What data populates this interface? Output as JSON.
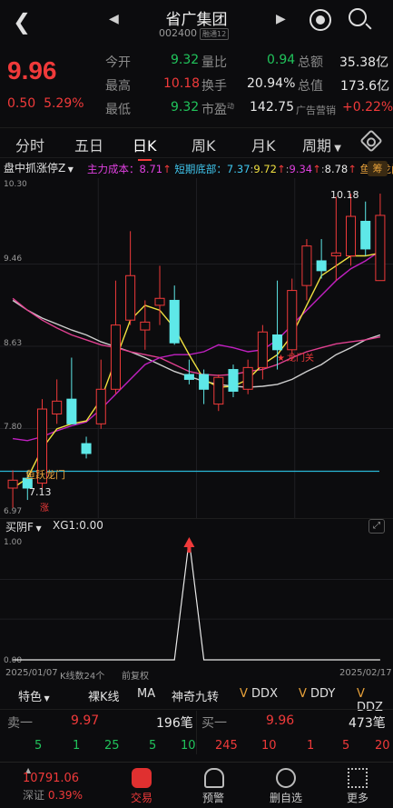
{
  "header": {
    "title": "省广集团",
    "code": "002400",
    "badge": "融通12"
  },
  "quote": {
    "price": "9.96",
    "change": "0.50",
    "change_pct": "5.29%",
    "rows": [
      {
        "l1": "今开",
        "v1": "9.32",
        "l2": "量比",
        "v2": "0.94",
        "l3": "总额",
        "v3": "35.38亿"
      },
      {
        "l1": "最高",
        "v1": "10.18",
        "l2": "换手",
        "v2": "20.94%",
        "l3": "总值",
        "v3": "173.6亿"
      },
      {
        "l1": "最低",
        "v1": "9.32",
        "l2": "市盈",
        "l2sup": "动",
        "v2": "142.75",
        "l3": "广告营销",
        "v3": "+0.22%"
      }
    ]
  },
  "tabs": [
    "分时",
    "五日",
    "日K",
    "周K",
    "月K",
    "周期"
  ],
  "indicator": {
    "selector": "盘中抓涨停Z",
    "main_cost_label": "主力成本：",
    "main_cost": "8.71",
    "short_bottom_label": "短期底部：",
    "short_bottom": "7.37",
    "v1": "9.72",
    "v2": "9.34",
    "v3": "8.78",
    "tail": "鱼跃龙门",
    "pill": "筹"
  },
  "price_axis": [
    "10.30",
    "9.46",
    "8.63",
    "7.80",
    "6.97"
  ],
  "annotations": {
    "high": "10.18",
    "low": "7.13",
    "yuyue": "鱼跃龙门",
    "longmen": "龙门关",
    "zhang": "涨"
  },
  "sub": {
    "selector": "买阴F",
    "xg_label": "XG1:",
    "xg_value": "0.00",
    "axis_top": "1.00",
    "axis_bottom": "0.00"
  },
  "date_row": {
    "start": "2025/01/07",
    "count": "K线数24个",
    "adj": "前复权",
    "end": "2025/02/17"
  },
  "tools": [
    "特色",
    "裸K线",
    "MA",
    "神奇九转",
    "DDX",
    "DDY",
    "DDZ"
  ],
  "orders": {
    "sell_label": "卖一",
    "sell_price": "9.97",
    "sell_vol": "196笔",
    "buy_label": "买一",
    "buy_price": "9.96",
    "buy_vol": "473笔",
    "sell_detail": [
      "5",
      "1",
      "25",
      "5",
      "10"
    ],
    "buy_detail": [
      "245",
      "10",
      "1",
      "5",
      "20"
    ]
  },
  "index": {
    "value": "10791.06",
    "name": "深证",
    "pct": "0.39%"
  },
  "nav": [
    "交易",
    "预警",
    "删自选",
    "更多"
  ],
  "chart_data": {
    "type": "candlestick",
    "ylim": [
      6.97,
      10.3
    ],
    "candles": [
      {
        "o": 7.2,
        "h": 7.38,
        "l": 7.0,
        "c": 7.28
      },
      {
        "o": 7.3,
        "h": 7.38,
        "l": 7.08,
        "c": 7.2
      },
      {
        "o": 7.25,
        "h": 8.1,
        "l": 7.2,
        "c": 8.0
      },
      {
        "o": 7.95,
        "h": 8.3,
        "l": 7.85,
        "c": 8.08
      },
      {
        "o": 8.1,
        "h": 8.52,
        "l": 7.9,
        "c": 7.85
      },
      {
        "o": 7.65,
        "h": 7.72,
        "l": 7.5,
        "c": 7.55
      },
      {
        "o": 7.85,
        "h": 8.5,
        "l": 7.8,
        "c": 8.2
      },
      {
        "o": 8.2,
        "h": 9.3,
        "l": 8.15,
        "c": 8.85
      },
      {
        "o": 8.9,
        "h": 9.8,
        "l": 8.85,
        "c": 9.35
      },
      {
        "o": 8.8,
        "h": 9.1,
        "l": 8.6,
        "c": 8.88
      },
      {
        "o": 9.05,
        "h": 9.45,
        "l": 8.85,
        "c": 9.12
      },
      {
        "o": 9.1,
        "h": 9.25,
        "l": 8.65,
        "c": 8.67
      },
      {
        "o": 8.35,
        "h": 8.5,
        "l": 8.25,
        "c": 8.3
      },
      {
        "o": 8.35,
        "h": 8.4,
        "l": 8.05,
        "c": 8.2
      },
      {
        "o": 8.05,
        "h": 8.35,
        "l": 7.98,
        "c": 8.32
      },
      {
        "o": 8.4,
        "h": 8.45,
        "l": 8.12,
        "c": 8.18
      },
      {
        "o": 8.2,
        "h": 8.5,
        "l": 8.15,
        "c": 8.42
      },
      {
        "o": 8.42,
        "h": 8.85,
        "l": 8.3,
        "c": 8.78
      },
      {
        "o": 8.75,
        "h": 9.3,
        "l": 8.4,
        "c": 8.6
      },
      {
        "o": 8.6,
        "h": 9.32,
        "l": 8.55,
        "c": 9.2
      },
      {
        "o": 9.25,
        "h": 9.72,
        "l": 9.1,
        "c": 9.65
      },
      {
        "o": 9.5,
        "h": 9.72,
        "l": 9.32,
        "c": 9.4
      },
      {
        "o": 9.55,
        "h": 10.15,
        "l": 9.3,
        "c": 9.58
      },
      {
        "o": 9.55,
        "h": 10.18,
        "l": 9.45,
        "c": 9.95
      },
      {
        "o": 9.9,
        "h": 10.1,
        "l": 9.55,
        "c": 9.62
      },
      {
        "o": 9.3,
        "h": 10.18,
        "l": 9.32,
        "c": 9.96
      }
    ],
    "ma_yellow": [
      7.2,
      7.3,
      7.6,
      7.8,
      7.85,
      7.88,
      8.1,
      8.5,
      8.9,
      9.05,
      9.0,
      8.82,
      8.55,
      8.3,
      8.22,
      8.23,
      8.3,
      8.45,
      8.55,
      8.75,
      9.05,
      9.35,
      9.45,
      9.55,
      9.55,
      9.58
    ],
    "ma_magenta": [
      7.7,
      7.68,
      7.72,
      7.78,
      7.83,
      7.87,
      8.0,
      8.15,
      8.3,
      8.45,
      8.52,
      8.55,
      8.55,
      8.58,
      8.65,
      8.62,
      8.58,
      8.6,
      8.7,
      8.85,
      9.0,
      9.15,
      9.3,
      9.42,
      9.5,
      9.6
    ],
    "ma_grey": [
      9.1,
      9.0,
      8.92,
      8.86,
      8.8,
      8.75,
      8.68,
      8.63,
      8.58,
      8.52,
      8.45,
      8.38,
      8.33,
      8.28,
      8.25,
      8.23,
      8.22,
      8.23,
      8.25,
      8.3,
      8.38,
      8.45,
      8.55,
      8.62,
      8.7,
      8.75
    ],
    "ma_pink": [
      9.12,
      9.0,
      8.9,
      8.82,
      8.75,
      8.7,
      8.65,
      8.62,
      8.58,
      8.55,
      8.52,
      8.45,
      8.38,
      8.35,
      8.34,
      8.35,
      8.38,
      8.4,
      8.45,
      8.52,
      8.58,
      8.62,
      8.66,
      8.68,
      8.7,
      8.73
    ],
    "cyan_level": 7.37,
    "sub_values": [
      0,
      0,
      0,
      0,
      0,
      0,
      0,
      0,
      0,
      0,
      0,
      0,
      1,
      0,
      0,
      0,
      0,
      0,
      0,
      0,
      0,
      0,
      0,
      0,
      0,
      0
    ]
  }
}
